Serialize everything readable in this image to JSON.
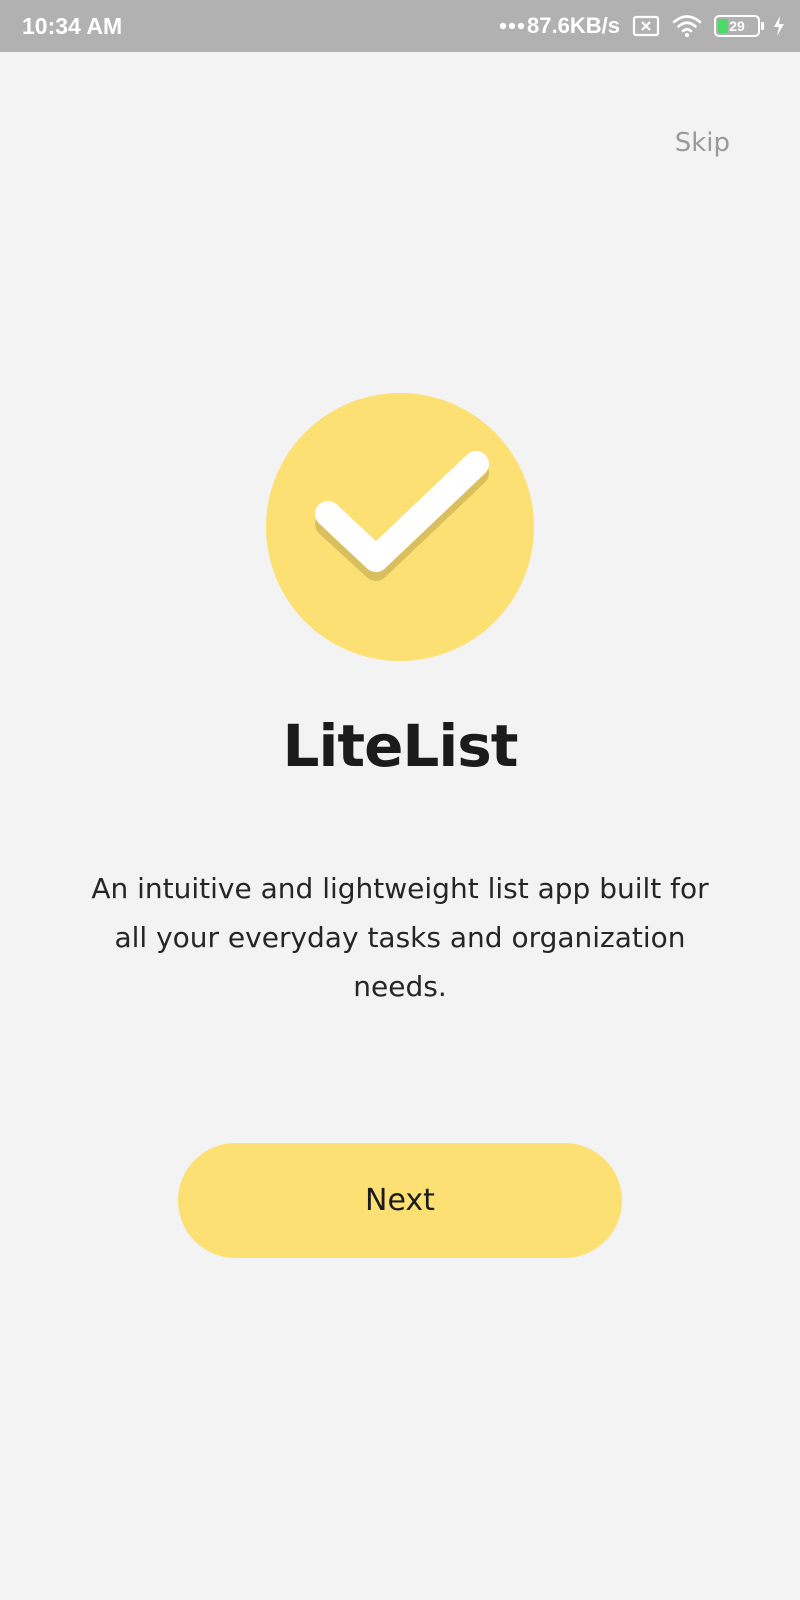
{
  "status_bar": {
    "time": "10:34 AM",
    "net_speed": "87.6KB/s",
    "battery_level": "29",
    "icons": [
      "more-dots-icon",
      "sim-x-icon",
      "wifi-icon",
      "battery-icon",
      "charging-icon"
    ]
  },
  "onboarding": {
    "skip_label": "Skip",
    "logo_icon": "checkmark-icon",
    "title": "LiteList",
    "description": "An intuitive and lightweight list app built for all your everyday tasks and organization needs.",
    "next_label": "Next"
  },
  "colors": {
    "accent": "#fde074",
    "background": "#f3f3f3",
    "status_bar": "#b1b1b1"
  }
}
